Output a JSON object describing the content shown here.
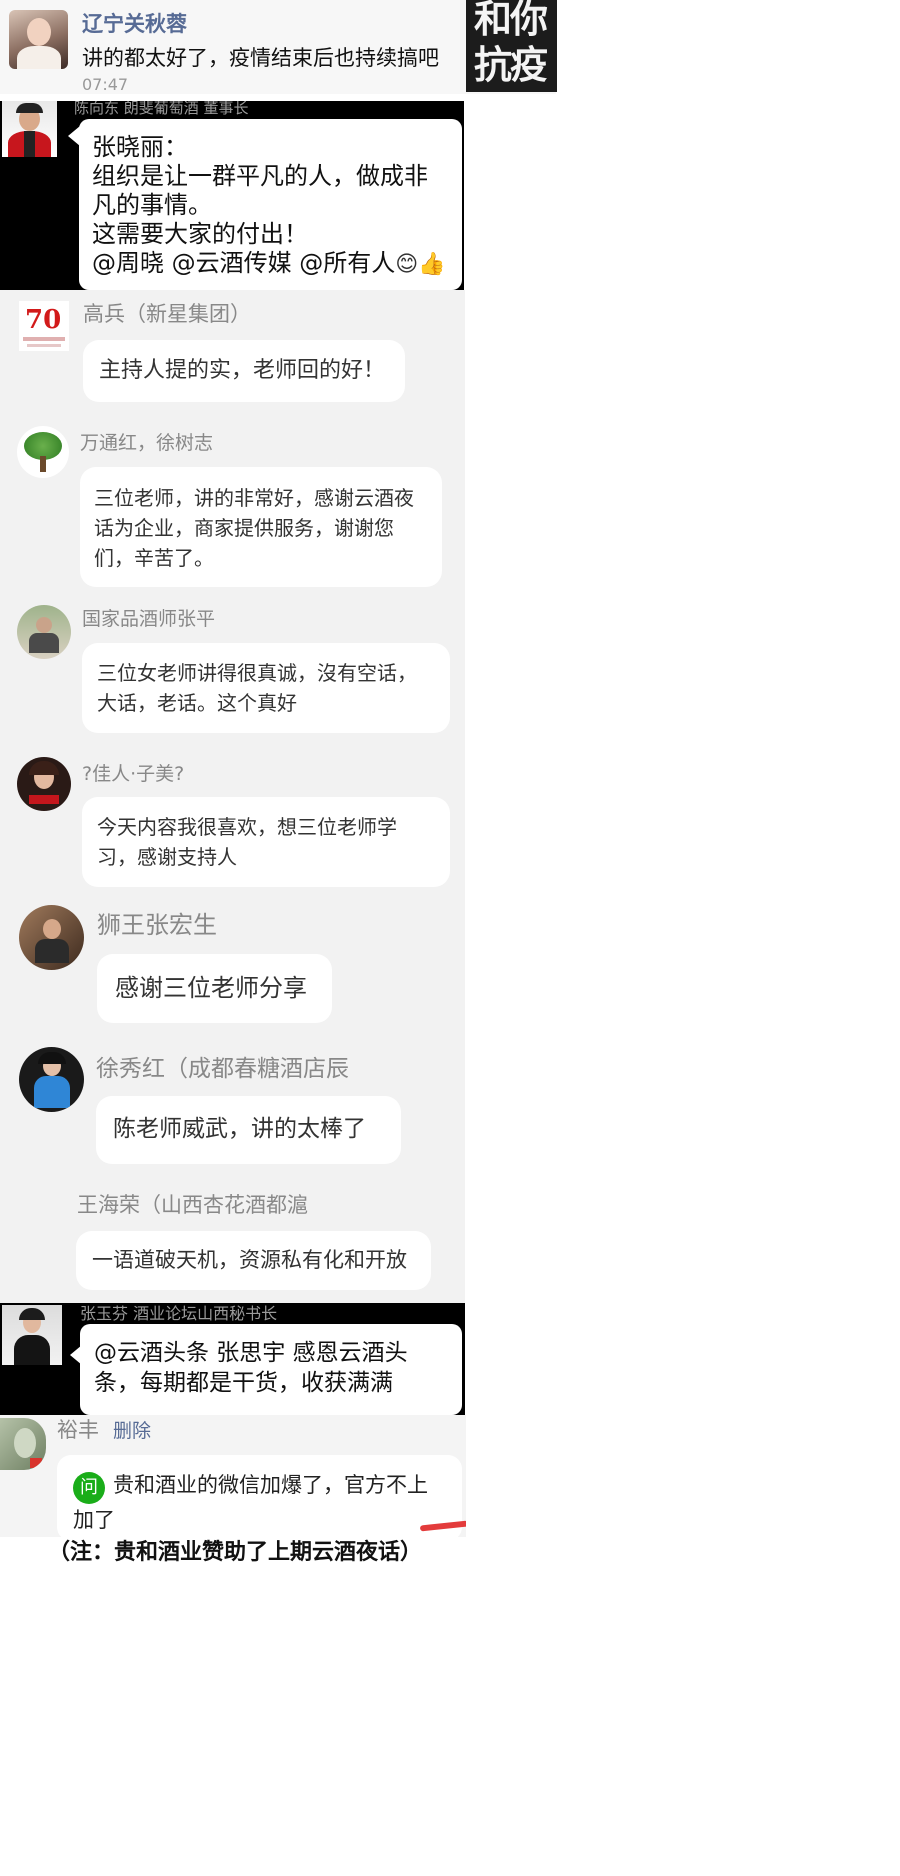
{
  "messages": [
    {
      "sender": "辽宁关秋蓉",
      "text": "讲的都太好了，疫情结束后也持续搞吧",
      "time": "07:47",
      "thumb_text": "和你\n抗疫"
    },
    {
      "sender": "陈向东 朗斐葡萄酒 董事长",
      "text": "张晓丽：\n组织是让一群平凡的人，做成非凡的事情。\n这需要大家的付出！\n@周晓 @云酒传媒 @所有人",
      "emoji": "😊👍"
    },
    {
      "sender": "高兵（新星集团）",
      "text": "主持人提的实，老师回的好！"
    },
    {
      "sender": "万通红，徐树志",
      "text": "三位老师，讲的非常好，感谢云酒夜话为企业，商家提供服务，谢谢您们，辛苦了。"
    },
    {
      "sender": "国家品酒师张平",
      "text": "三位女老师讲得很真诚，沒有空话，大话，老话。这个真好"
    },
    {
      "sender": "?佳人·子美?",
      "text": "今天内容我很喜欢，想三位老师学习，感谢支持人"
    },
    {
      "sender": "狮王张宏生",
      "text": "感谢三位老师分享"
    },
    {
      "sender": "徐秀红（成都春糖酒店辰",
      "text": "陈老师威武，讲的太棒了"
    },
    {
      "sender": "王海荣（山西杏花酒都滬",
      "text": "一语道破天机，资源私有化和开放"
    },
    {
      "sender": "张玉芬 酒业论坛山西秘书长",
      "text": "@云酒头条 张思宇 感恩云酒头条，每期都是干货，收获满满"
    },
    {
      "sender": "裕丰",
      "action": "删除",
      "badge": "问",
      "text": "贵和酒业的微信加爆了，官方不上加了"
    }
  ],
  "footer_note": "（注：贵和酒业赞助了上期云酒夜话）",
  "colors": {
    "chat_bg": "#f2f2f2",
    "bubble": "#ffffff",
    "name_gray": "#888888",
    "name_blue": "#576b95",
    "badge_green": "#1aad19",
    "dark_panel": "#000000"
  }
}
